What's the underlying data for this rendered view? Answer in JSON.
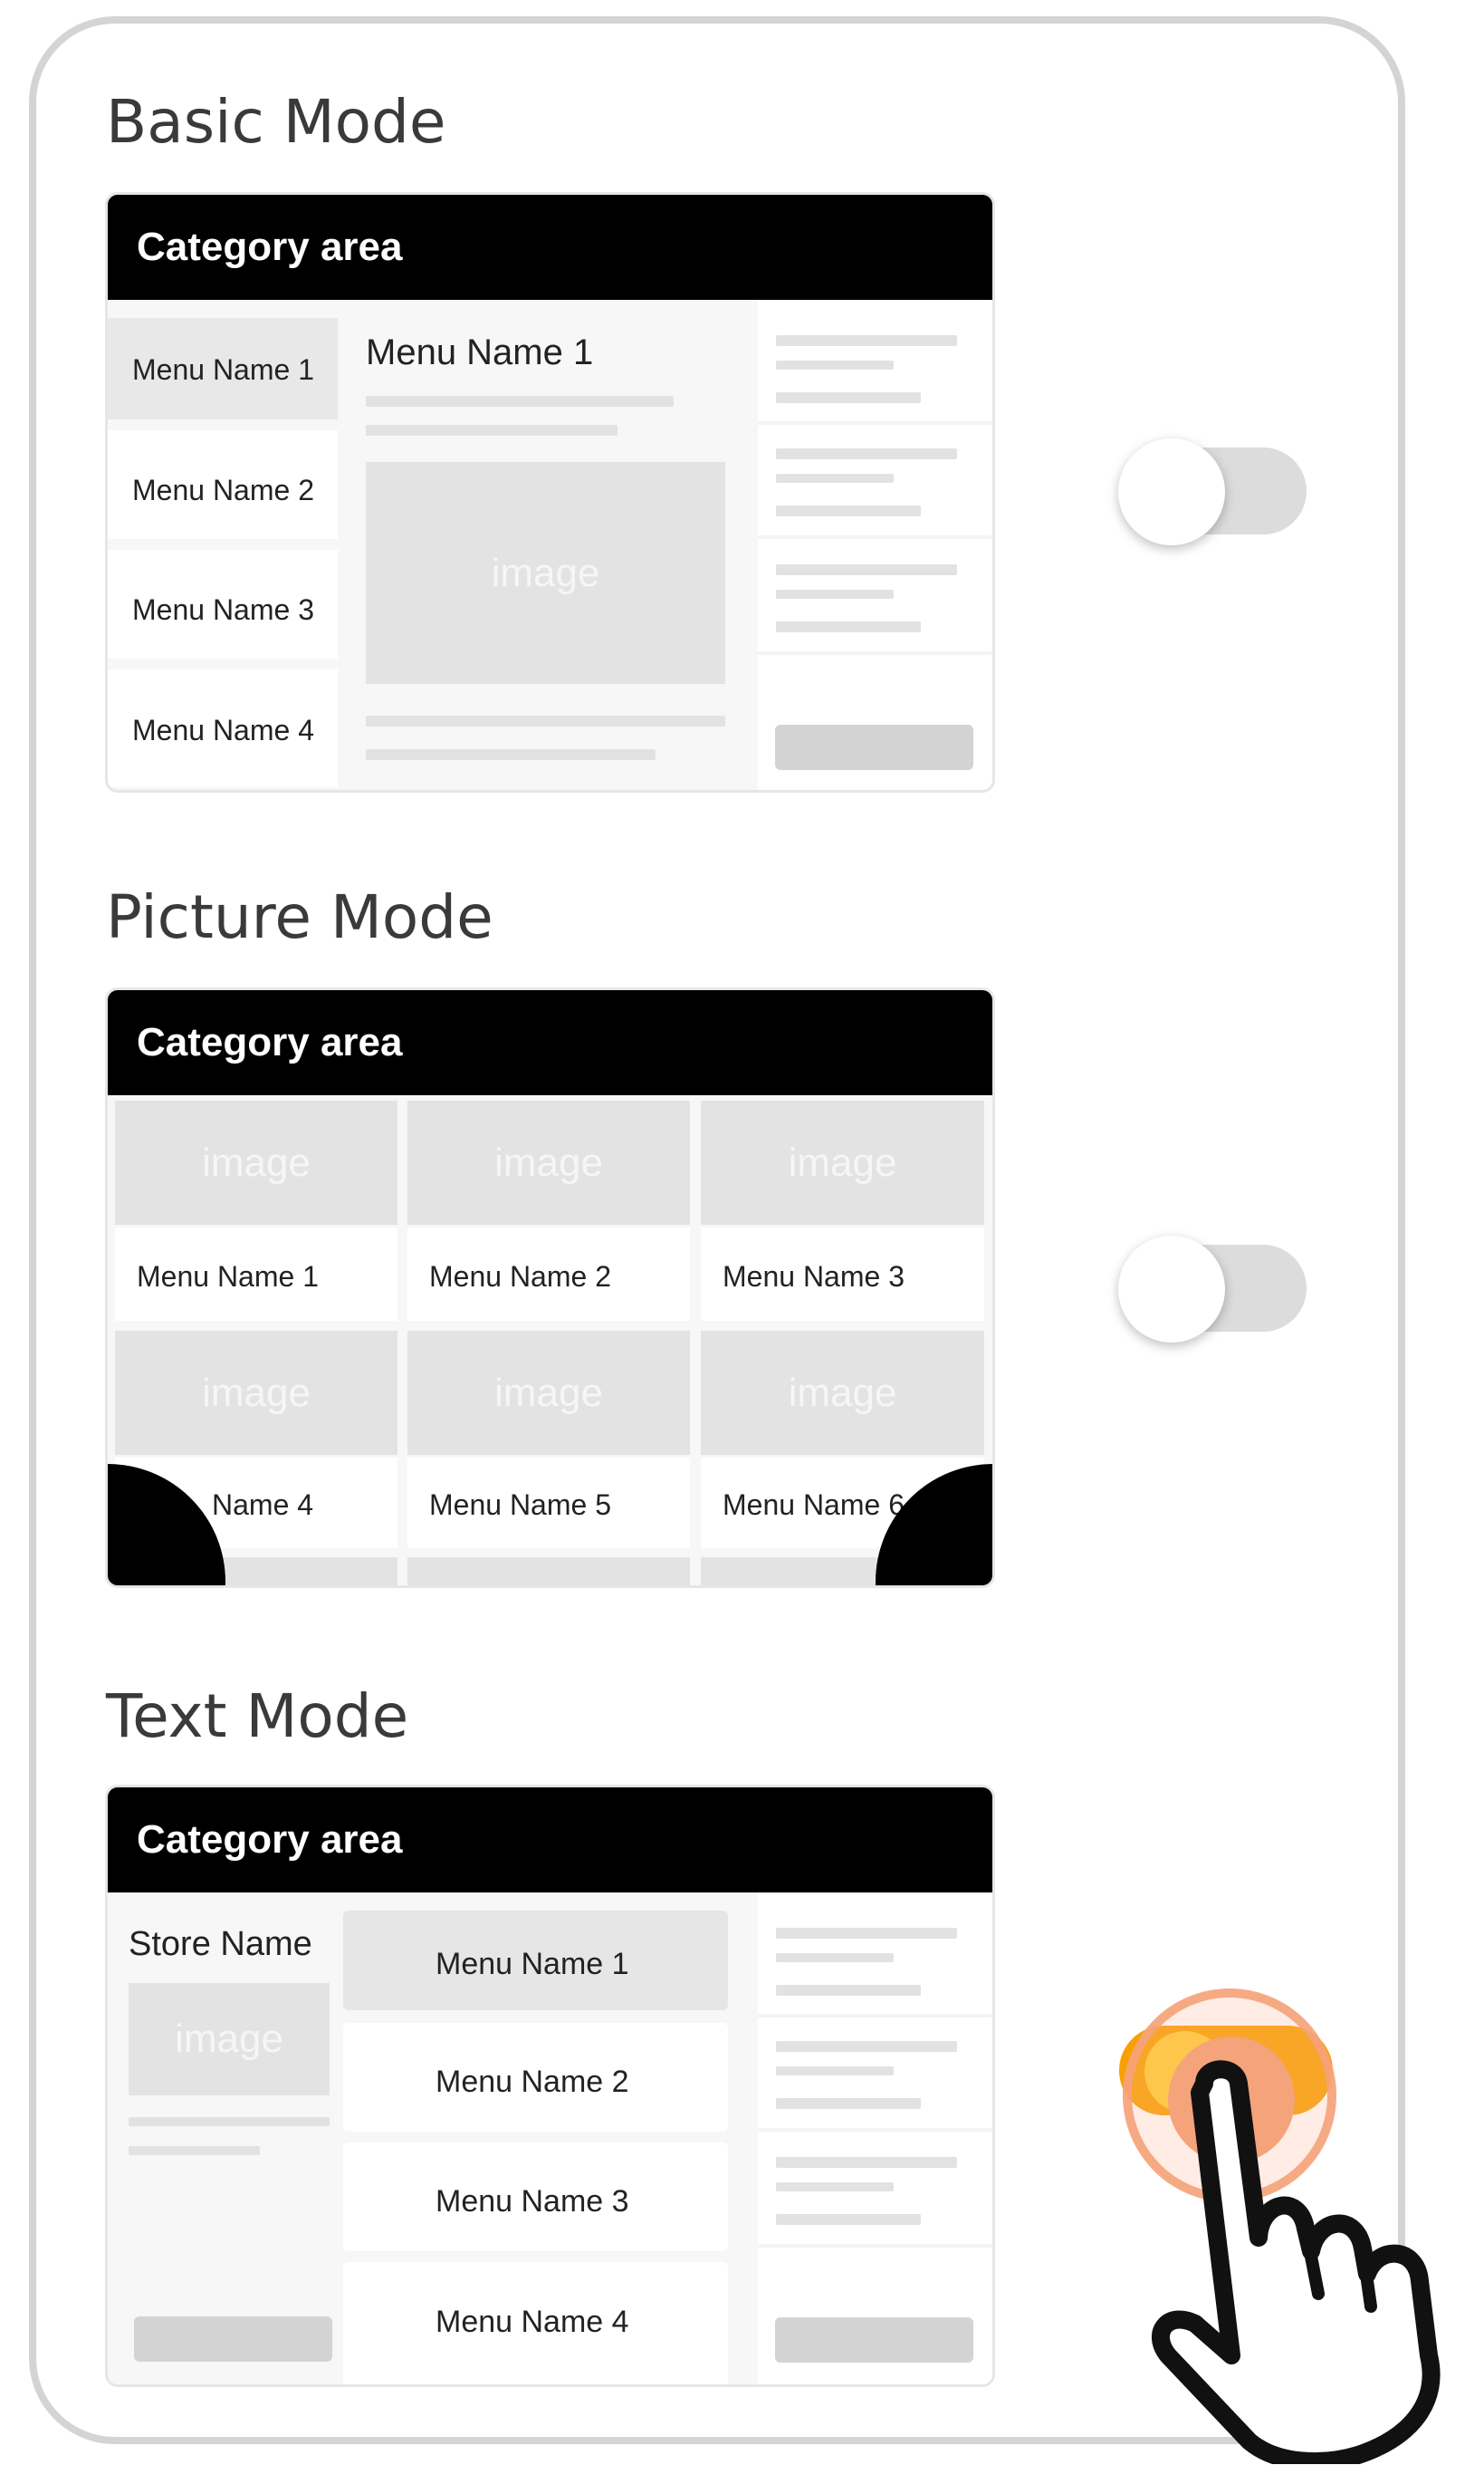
{
  "modes": {
    "basic": {
      "title": "Basic Mode",
      "category": "Category area",
      "sidebar": [
        "Menu Name 1",
        "Menu Name 2",
        "Menu Name 3",
        "Menu Name 4"
      ],
      "detail_title": "Menu Name 1",
      "image_label": "image",
      "toggle_on": false
    },
    "picture": {
      "title": "Picture Mode",
      "category": "Category area",
      "image_label": "image",
      "items": [
        "Menu Name 1",
        "Menu Name 2",
        "Menu Name 3",
        "Name 4",
        "Menu Name 5",
        "Menu Name 6"
      ],
      "toggle_on": false
    },
    "text": {
      "title": "Text Mode",
      "category": "Category area",
      "store_name": "Store Name",
      "image_label": "image",
      "items": [
        "Menu Name 1",
        "Menu Name 2",
        "Menu Name 3",
        "Menu Name 4"
      ],
      "toggle_on": true
    }
  },
  "colors": {
    "frame_border": "#d4d4d4",
    "category_bar": "#000000",
    "placeholder": "#e3e3e3",
    "toggle_active": "#f7a000",
    "tap_highlight": "#f5a37a"
  }
}
